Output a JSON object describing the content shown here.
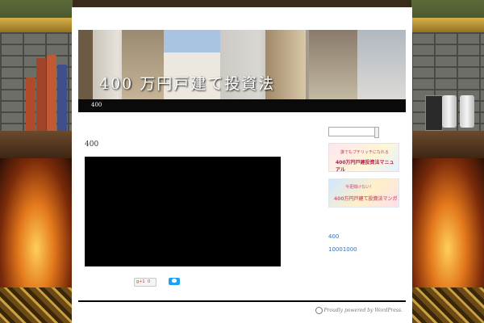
{
  "site": {
    "title": "400 万円戸建て投資法"
  },
  "nav": {
    "items": [
      {
        "label": "400"
      }
    ]
  },
  "post": {
    "title": "400"
  },
  "share": {
    "gplus_label": "g+1",
    "gplus_count": "0"
  },
  "sidebar": {
    "banner1": {
      "line1": "誰でもプチリッチになれる",
      "line2": "400万円戸建投資法マニュアル"
    },
    "banner2": {
      "line1": "今更聞けない！",
      "line2": "400万円戸建て投資法マンガ"
    },
    "links": [
      "400",
      "10001000"
    ]
  },
  "footer": {
    "text": "Proudly powered by WordPress."
  }
}
